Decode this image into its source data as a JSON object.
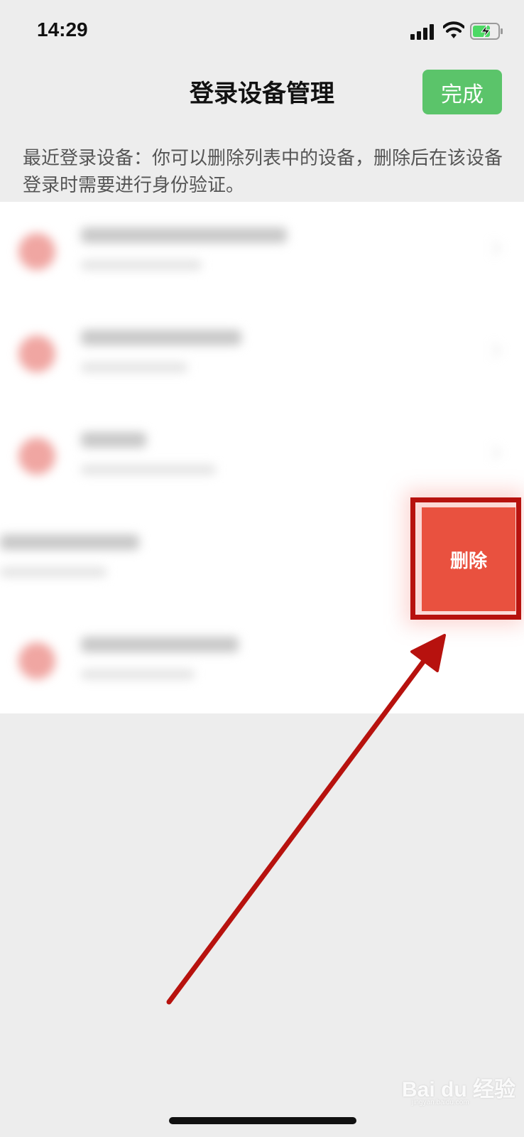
{
  "status_bar": {
    "time": "14:29",
    "icons": [
      "signal-icon",
      "wifi-icon",
      "battery-charging-icon"
    ]
  },
  "nav": {
    "title": "登录设备管理",
    "done_label": "完成"
  },
  "description": "最近登录设备：你可以删除列表中的设备，删除后在该设备登录时需要进行身份验证。",
  "swipe_action": {
    "delete_label": "删除"
  },
  "colors": {
    "done_button": "#5bc46a",
    "delete_button": "#e9513f",
    "annotation": "#b7120e"
  },
  "watermark": {
    "text": "Bai du 经验",
    "sub": "jingyan.baidu.com"
  }
}
